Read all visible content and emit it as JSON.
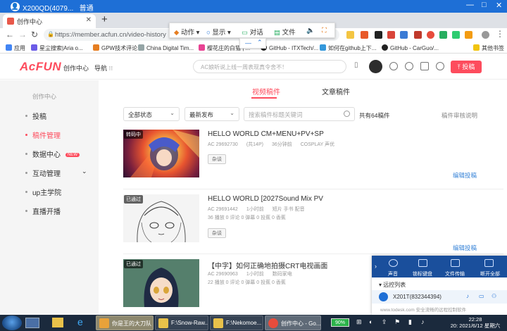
{
  "session": {
    "title": "X200QD(4079...",
    "status": "普通"
  },
  "browser": {
    "tab_title": "创作中心",
    "new_tab": "+",
    "url": "https://member.acfun.cn/video-history",
    "bookmarks": [
      "应用",
      "星尘搜索|Aria o...",
      "GPW技术评论",
      "China Digital Tim...",
      "樱花庄的白猫 | ...",
      "GitHub - ITXTech/...",
      "如何在github上下...",
      "GitHub - CarGuo/...",
      "其他书签"
    ]
  },
  "remote_toolbar": {
    "action": "动作",
    "display": "显示",
    "chat": "对话",
    "file": "文件"
  },
  "header": {
    "logo": "AcFUN",
    "nav_center": "创作中心",
    "nav_guide": "导航",
    "search_placeholder": "AC娘听说上线一周表现真令舍不！",
    "post_button": "投稿"
  },
  "sidebar": {
    "head": "创作中心",
    "items": [
      {
        "label": "投稿"
      },
      {
        "label": "稿件管理"
      },
      {
        "label": "数据中心",
        "badge": "NEW"
      },
      {
        "label": "互动管理"
      },
      {
        "label": "up主学院"
      },
      {
        "label": "直播开播"
      }
    ]
  },
  "main": {
    "tabs": [
      "视频稿件",
      "文章稿件"
    ],
    "filter_status": "全部状态",
    "filter_sort": "最新发布",
    "search_placeholder": "搜索稿件标题关键词",
    "count": "共有64稿件",
    "review_note": "稿件审核说明",
    "edit_label": "编辑投稿",
    "items": [
      {
        "status": "转码中",
        "title": "HELLO WORLD CM+MENU+PV+SP",
        "ac": "AC 29692730",
        "parts": "(共14P)",
        "time": "36分钟前",
        "tag_line": "COSPLAY 声优",
        "tag": "杂谈",
        "stats": ""
      },
      {
        "status": "已通过",
        "title": "HELLO WORLD [2027Sound Mix PV",
        "ac": "AC 29691442",
        "parts": "",
        "time": "1小时前",
        "tag_line": "短片 手书 配音",
        "tag": "杂谈",
        "stats": "36 播放   0 评论   0 弹幕   0 投蕉   0 香蕉"
      },
      {
        "status": "已通过",
        "title": "【中字】如何正确地拍摄CRT电视画面",
        "ac": "AC 29690963",
        "parts": "",
        "time": "1小时前",
        "tag_line": "数码家电",
        "tag": "",
        "stats": "22 播放   0 评论   0 弹幕   0 投蕉   0 香蕉"
      }
    ]
  },
  "todesk": {
    "buttons": [
      "声音",
      "锁标键盘",
      "文件传输",
      "断开全部"
    ],
    "list_title": "远控列表",
    "device": "X201T(832344394)",
    "footer": "www.todesk.com 安全流畅的远程控制软件"
  },
  "taskbar": {
    "items": [
      "你是王的大刀队",
      "F:\\Snow-Raw...",
      "F:\\Nekomoe...",
      "创作中心 - Go..."
    ],
    "battery": "90%",
    "time": "22:28",
    "date": "20: 2021/6/12 星期六"
  },
  "colors": {
    "accent": "#fd4c5d",
    "link": "#3b86d8",
    "remote_bar": "#1e6fd6"
  }
}
